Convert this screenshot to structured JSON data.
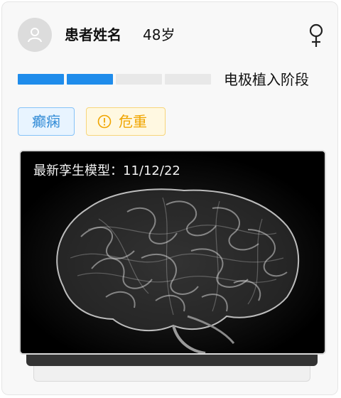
{
  "patient": {
    "name": "患者姓名",
    "age": "48岁",
    "gender_icon": "female-icon"
  },
  "progress": {
    "label": "电极植入阶段",
    "completed_segments": 2,
    "total_segments": 4,
    "active_color": "#1f8ceb",
    "inactive_color": "#e8e8e8"
  },
  "tags": {
    "diagnosis": "癫痫",
    "severity": "危重",
    "severity_icon": "alert-circle-icon"
  },
  "viewer": {
    "caption_prefix": "最新孪生模型：",
    "caption_date": "11/12/22",
    "image": "brain-3d-model"
  }
}
